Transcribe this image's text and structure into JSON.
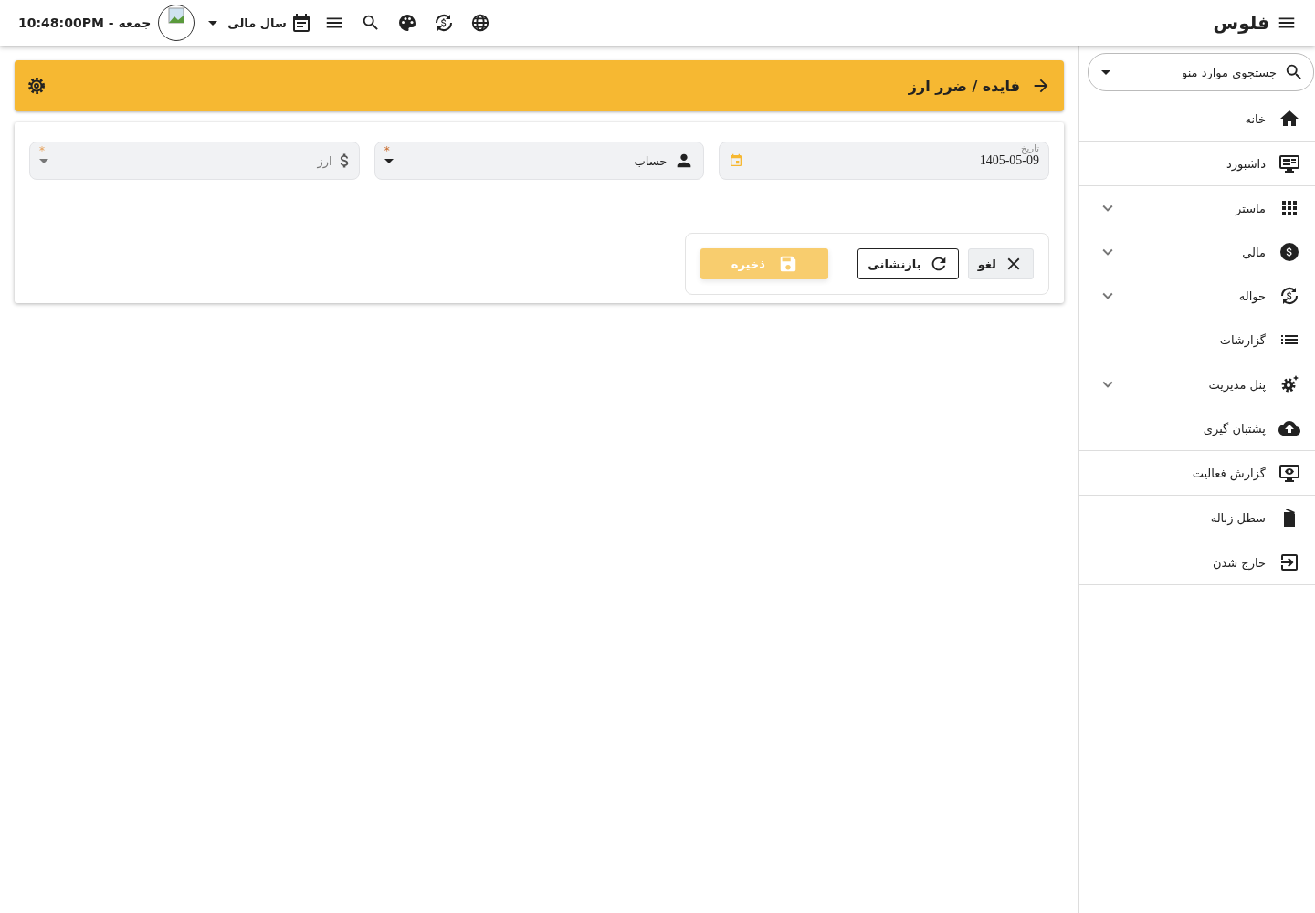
{
  "app": {
    "title": "فلوس"
  },
  "topbar": {
    "clock": "10:48:00PM - جمعه",
    "fiscal_year": "سال مالی"
  },
  "sidebar": {
    "search_placeholder": "جستجوی موارد منو",
    "items": [
      {
        "label": "خانه",
        "kind": "link",
        "divider_after": true
      },
      {
        "label": "داشبورد",
        "kind": "link",
        "divider_after": true
      },
      {
        "label": "ماستر",
        "kind": "group",
        "expanded": false,
        "divider_after": false
      },
      {
        "label": "مالی",
        "kind": "group",
        "expanded": false,
        "divider_after": false
      },
      {
        "label": "حواله",
        "kind": "group",
        "expanded": false,
        "divider_after": false
      },
      {
        "label": "گزارشات",
        "kind": "link",
        "divider_after": true
      },
      {
        "label": "پنل مدیریت",
        "kind": "group",
        "expanded": false,
        "divider_after": false
      },
      {
        "label": "پشتبان گیری",
        "kind": "link",
        "divider_after": true
      },
      {
        "label": "گزارش فعالیت",
        "kind": "link",
        "divider_after": true
      },
      {
        "label": "سطل زباله",
        "kind": "link",
        "divider_after": true
      },
      {
        "label": "خارج شدن",
        "kind": "link",
        "divider_after": true
      }
    ]
  },
  "page": {
    "title": "فایده / ضرر ارز",
    "fields": [
      {
        "kind": "date",
        "label": "تاریخ",
        "value": "1405-05-09",
        "disabled": false
      },
      {
        "kind": "select",
        "label": "حساب",
        "required_mark": "*",
        "disabled": false
      },
      {
        "kind": "select",
        "label": "ارز",
        "required_mark": "*",
        "disabled": true
      }
    ],
    "buttons": [
      {
        "kind": "cancel",
        "label": "لغو",
        "disabled": false
      },
      {
        "kind": "reset",
        "label": "بازنشانی",
        "disabled": false
      },
      {
        "kind": "save",
        "label": "ذخیره",
        "disabled": true
      }
    ]
  }
}
